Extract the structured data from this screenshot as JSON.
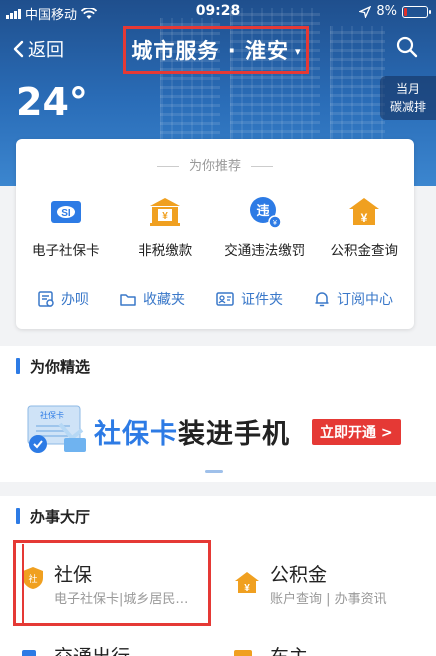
{
  "status_bar": {
    "carrier": "中国移动",
    "time": "09:28",
    "battery": "8%"
  },
  "nav": {
    "back_label": "返回",
    "title": "城市服务 · 淮安",
    "caret": "▾"
  },
  "weather": {
    "temperature": "24°",
    "carbon_line1": "当月",
    "carbon_line2": "碳减排"
  },
  "recommend": {
    "label": "为你推荐",
    "services": [
      {
        "label": "电子社保卡",
        "icon": "social-security-card-icon"
      },
      {
        "label": "非税缴款",
        "icon": "bank-icon"
      },
      {
        "label": "交通违法缴罚",
        "icon": "traffic-violation-icon"
      },
      {
        "label": "公积金查询",
        "icon": "housing-fund-icon"
      }
    ],
    "links": [
      {
        "label": "办呗",
        "icon": "document-icon"
      },
      {
        "label": "收藏夹",
        "icon": "folder-icon"
      },
      {
        "label": "证件夹",
        "icon": "id-card-icon"
      },
      {
        "label": "订阅中心",
        "icon": "bell-icon"
      }
    ]
  },
  "featured": {
    "header": "为你精选",
    "banner": {
      "highlight": "社保卡",
      "rest": "装进手机",
      "button": "立即开通 >",
      "card_text": "社保卡"
    }
  },
  "hall": {
    "header": "办事大厅",
    "items": [
      {
        "name": "社保",
        "sub": "电子社保卡|城乡居民…",
        "icon": "shield-icon"
      },
      {
        "name": "公积金",
        "sub": "账户查询 | 办事资讯",
        "icon": "house-yen-icon"
      },
      {
        "name": "交通出行",
        "icon": "car-icon"
      },
      {
        "name": "车主",
        "icon": "car-owner-icon"
      }
    ]
  },
  "colors": {
    "accent": "#2d7be5",
    "highlight": "#e53935",
    "gold": "#f0a020"
  }
}
